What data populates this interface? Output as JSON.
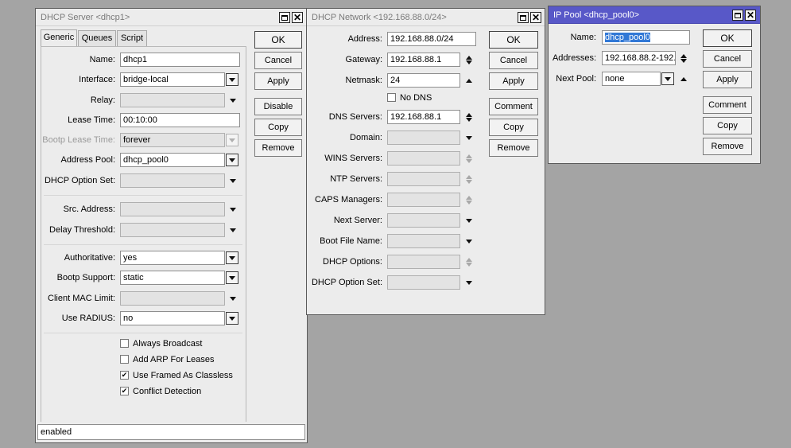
{
  "dhcp_server": {
    "title": "DHCP Server <dhcp1>",
    "tabs": [
      "Generic",
      "Queues",
      "Script"
    ],
    "fields": {
      "name": {
        "label": "Name:",
        "value": "dhcp1"
      },
      "interface": {
        "label": "Interface:",
        "value": "bridge-local"
      },
      "relay": {
        "label": "Relay:",
        "value": ""
      },
      "lease_time": {
        "label": "Lease Time:",
        "value": "00:10:00"
      },
      "bootp_lease_time": {
        "label": "Bootp Lease Time:",
        "value": "forever"
      },
      "address_pool": {
        "label": "Address Pool:",
        "value": "dhcp_pool0"
      },
      "dhcp_option_set": {
        "label": "DHCP Option Set:",
        "value": ""
      },
      "src_address": {
        "label": "Src. Address:",
        "value": ""
      },
      "delay_threshold": {
        "label": "Delay Threshold:",
        "value": ""
      },
      "authoritative": {
        "label": "Authoritative:",
        "value": "yes"
      },
      "bootp_support": {
        "label": "Bootp Support:",
        "value": "static"
      },
      "client_mac_limit": {
        "label": "Client MAC Limit:",
        "value": ""
      },
      "use_radius": {
        "label": "Use RADIUS:",
        "value": "no"
      }
    },
    "checkboxes": [
      {
        "label": "Always Broadcast",
        "checked": false
      },
      {
        "label": "Add ARP For Leases",
        "checked": false
      },
      {
        "label": "Use Framed As Classless",
        "checked": true
      },
      {
        "label": "Conflict Detection",
        "checked": true
      }
    ],
    "buttons": [
      "OK",
      "Cancel",
      "Apply",
      "Disable",
      "Copy",
      "Remove"
    ],
    "status": "enabled"
  },
  "dhcp_network": {
    "title": "DHCP Network <192.168.88.0/24>",
    "fields": {
      "address": {
        "label": "Address:",
        "value": "192.168.88.0/24"
      },
      "gateway": {
        "label": "Gateway:",
        "value": "192.168.88.1"
      },
      "netmask": {
        "label": "Netmask:",
        "value": "24"
      },
      "dns_servers": {
        "label": "DNS Servers:",
        "value": "192.168.88.1"
      },
      "domain": {
        "label": "Domain:",
        "value": ""
      },
      "wins_servers": {
        "label": "WINS Servers:",
        "value": ""
      },
      "ntp_servers": {
        "label": "NTP Servers:",
        "value": ""
      },
      "caps_managers": {
        "label": "CAPS Managers:",
        "value": ""
      },
      "next_server": {
        "label": "Next Server:",
        "value": ""
      },
      "boot_file_name": {
        "label": "Boot File Name:",
        "value": ""
      },
      "dhcp_options": {
        "label": "DHCP Options:",
        "value": ""
      },
      "dhcp_option_set": {
        "label": "DHCP Option Set:",
        "value": ""
      }
    },
    "no_dns": {
      "label": "No DNS",
      "checked": false
    },
    "buttons": [
      "OK",
      "Cancel",
      "Apply",
      "Comment",
      "Copy",
      "Remove"
    ]
  },
  "ip_pool": {
    "title": "IP Pool <dhcp_pool0>",
    "fields": {
      "name": {
        "label": "Name:",
        "value": "dhcp_pool0"
      },
      "addresses": {
        "label": "Addresses:",
        "value": "192.168.88.2-192."
      },
      "next_pool": {
        "label": "Next Pool:",
        "value": "none"
      }
    },
    "buttons": [
      "OK",
      "Cancel",
      "Apply",
      "Comment",
      "Copy",
      "Remove"
    ]
  },
  "colors": {
    "desktop": "#a4a4a4",
    "active_title": "#5858c8",
    "window_bg": "#ececec"
  },
  "icons": [
    "maximize-icon",
    "close-icon",
    "dropdown-arrow-icon",
    "spin-up-down-icon",
    "checkmark-icon"
  ]
}
